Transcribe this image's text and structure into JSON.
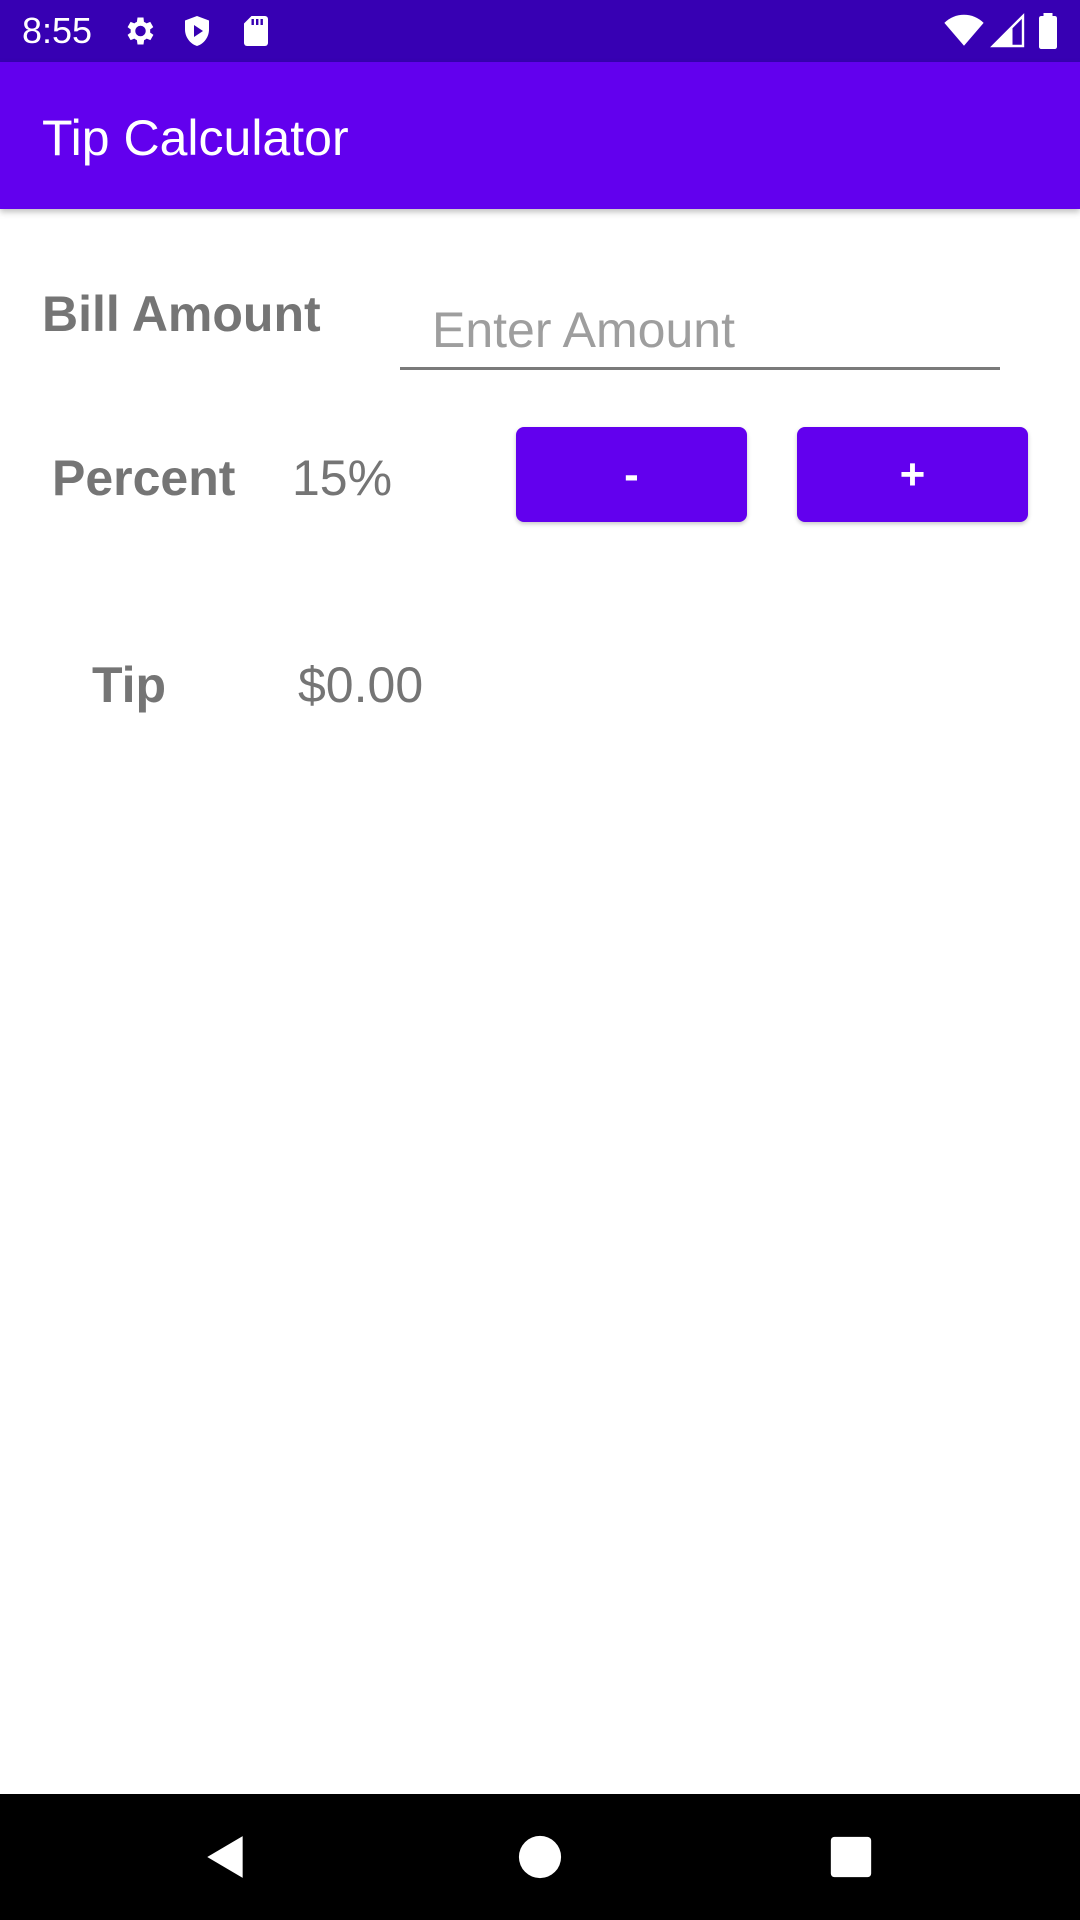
{
  "status_bar": {
    "time": "8:55",
    "icons_left": [
      "gear-icon",
      "shield-icon",
      "sd-card-icon"
    ],
    "icons_right": [
      "wifi-icon",
      "signal-icon",
      "battery-icon"
    ],
    "background": "#3700b3"
  },
  "app_bar": {
    "title": "Tip Calculator",
    "background": "#6200ee"
  },
  "bill": {
    "label": "Bill Amount",
    "input_value": "",
    "input_placeholder": "Enter Amount"
  },
  "percent": {
    "label": "Percent",
    "value": "15%",
    "decrease_label": "-",
    "increase_label": "+"
  },
  "tip": {
    "label": "Tip",
    "value": "$0.00"
  },
  "nav_bar": {
    "icons": [
      "back-icon",
      "home-icon",
      "recents-icon"
    ]
  },
  "colors": {
    "accent": "#6200ee",
    "status": "#3700b3",
    "text_gray": "#757575"
  }
}
